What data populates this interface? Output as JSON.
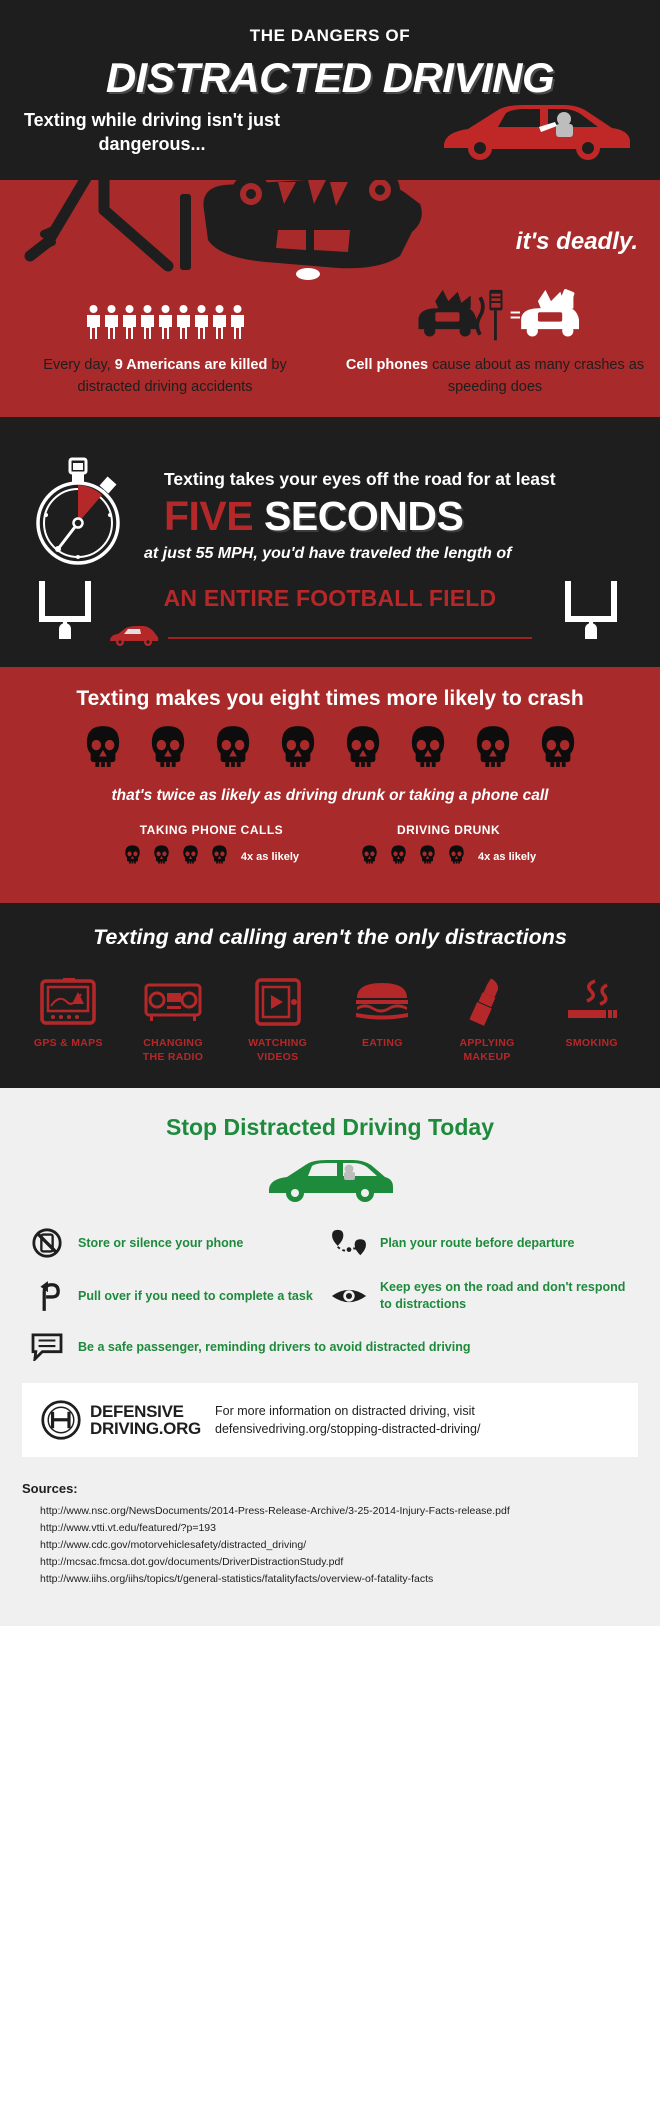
{
  "hero": {
    "kicker": "THE DANGERS OF",
    "title": "DISTRACTED DRIVING",
    "subtitle": "Texting while driving isn't just dangerous...",
    "car_icon": "red-car-driver-icon"
  },
  "deadly": {
    "tagline": "it's deadly.",
    "crash_art": "overturned-car-crash-icon",
    "stats": [
      {
        "icon": "nine-people-icon",
        "people_count": 9,
        "text_pre": "Every day, ",
        "text_hl": "9 Americans are killed",
        "text_post": " by distracted driving accidents"
      },
      {
        "icon": "cellphone-crash-equals-speeding-icon",
        "text_hl": "Cell phones",
        "text_post": " cause about as many crashes as speeding does"
      }
    ]
  },
  "five_seconds": {
    "stopwatch_icon": "stopwatch-icon",
    "line1": "Texting takes your eyes off the road for at least",
    "big_red": "FIVE",
    "big_white": "SECONDS",
    "line3": "at just 55 MPH, you'd have traveled the length of",
    "field_title": "AN ENTIRE FOOTBALL FIELD",
    "goalpost_icon": "goalpost-icon",
    "car_icon": "small-red-car-icon",
    "speed_mph": 55,
    "seconds": 5
  },
  "skulls": {
    "headline": "Texting makes you eight times more likely to crash",
    "skull_count": 8,
    "subline": "that's twice as likely as driving drunk or taking a phone call",
    "comparisons": [
      {
        "title": "TAKING PHONE CALLS",
        "skulls": 4,
        "note": "4x as likely"
      },
      {
        "title": "DRIVING DRUNK",
        "skulls": 4,
        "note": "4x as likely"
      }
    ]
  },
  "distractions": {
    "headline": "Texting and calling aren't the only distractions",
    "items": [
      {
        "icon": "gps-map-icon",
        "label": "GPS & MAPS"
      },
      {
        "icon": "radio-icon",
        "label": "CHANGING\nTHE RADIO"
      },
      {
        "icon": "tablet-video-icon",
        "label": "WATCHING\nVIDEOS"
      },
      {
        "icon": "burger-icon",
        "label": "EATING"
      },
      {
        "icon": "lipstick-icon",
        "label": "APPLYING\nMAKEUP"
      },
      {
        "icon": "cigarette-icon",
        "label": "SMOKING"
      }
    ]
  },
  "stop": {
    "headline": "Stop Distracted Driving Today",
    "car_icon": "green-car-icon",
    "tips": [
      {
        "icon": "no-phone-icon",
        "text": "Store or silence your phone"
      },
      {
        "icon": "route-pin-icon",
        "text": "Plan your route before departure"
      },
      {
        "icon": "pull-over-arrow-icon",
        "text": "Pull over if you need to complete a task"
      },
      {
        "icon": "eye-icon",
        "text": "Keep eyes on the road and don't respond to distractions"
      },
      {
        "icon": "speech-bubble-icon",
        "text": "Be a safe passenger, reminding drivers to avoid distracted driving"
      }
    ]
  },
  "cta": {
    "logo_icon": "defensive-driving-logo-icon",
    "brand_line1": "DEFENSIVE",
    "brand_line2": "DRIVING.ORG",
    "text": "For more information on distracted driving, visit defensivedriving.org/stopping-distracted-driving/"
  },
  "sources": {
    "title": "Sources:",
    "items": [
      "http://www.nsc.org/NewsDocuments/2014-Press-Release-Archive/3-25-2014-Injury-Facts-release.pdf",
      "http://www.vtti.vt.edu/featured/?p=193",
      "http://www.cdc.gov/motorvehiclesafety/distracted_driving/",
      "http://mcsac.fmcsa.dot.gov/documents/DriverDistractionStudy.pdf",
      "http://www.iihs.org/iihs/topics/t/general-statistics/fatalityfacts/overview-of-fatality-facts"
    ]
  },
  "colors": {
    "black": "#1e1e1e",
    "red": "#a82a2a",
    "red_accent": "#b5282a",
    "green": "#1e8a3c",
    "light": "#f0f0f0"
  }
}
